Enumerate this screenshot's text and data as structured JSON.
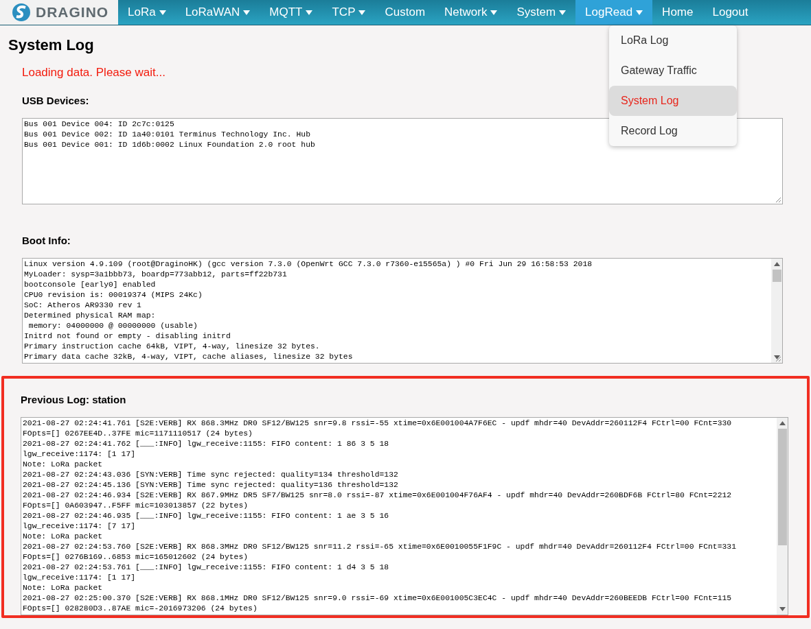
{
  "nav": {
    "logo": "DRAGINO",
    "items": [
      {
        "label": "LoRa",
        "dropdown": true,
        "selected": false
      },
      {
        "label": "LoRaWAN",
        "dropdown": true,
        "selected": false
      },
      {
        "label": "MQTT",
        "dropdown": true,
        "selected": false
      },
      {
        "label": "TCP",
        "dropdown": true,
        "selected": false
      },
      {
        "label": "Custom",
        "dropdown": false,
        "selected": false
      },
      {
        "label": "Network",
        "dropdown": true,
        "selected": false
      },
      {
        "label": "System",
        "dropdown": true,
        "selected": false
      },
      {
        "label": "LogRead",
        "dropdown": true,
        "selected": true
      },
      {
        "label": "Home",
        "dropdown": false,
        "selected": false
      },
      {
        "label": "Logout",
        "dropdown": false,
        "selected": false
      }
    ]
  },
  "dropdown": {
    "items": [
      {
        "label": "LoRa Log",
        "selected": false
      },
      {
        "label": "Gateway Traffic",
        "selected": false
      },
      {
        "label": "System Log",
        "selected": true
      },
      {
        "label": "Record Log",
        "selected": false
      }
    ]
  },
  "page_title": "System Log",
  "status_message": "Loading data. Please wait...",
  "sections": [
    {
      "heading": "USB Devices:",
      "scrollbar": false,
      "highlighted": false,
      "lines": [
        "Bus 001 Device 004: ID 2c7c:0125",
        "Bus 001 Device 002: ID 1a40:0101 Terminus Technology Inc. Hub",
        "Bus 001 Device 001: ID 1d6b:0002 Linux Foundation 2.0 root hub"
      ]
    },
    {
      "heading": "Boot Info:",
      "scrollbar": true,
      "highlighted": false,
      "lines": [
        "Linux version 4.9.109 (root@DraginoHK) (gcc version 7.3.0 (OpenWrt GCC 7.3.0 r7360-e15565a) ) #0 Fri Jun 29 16:58:53 2018",
        "MyLoader: sysp=3a1bbb73, boardp=773abb12, parts=ff22b731",
        "bootconsole [early0] enabled",
        "CPU0 revision is: 00019374 (MIPS 24Kc)",
        "SoC: Atheros AR9330 rev 1",
        "Determined physical RAM map:",
        " memory: 04000000 @ 00000000 (usable)",
        "Initrd not found or empty - disabling initrd",
        "Primary instruction cache 64kB, VIPT, 4-way, linesize 32 bytes.",
        "Primary data cache 32kB, 4-way, VIPT, cache aliases, linesize 32 bytes"
      ]
    },
    {
      "heading": "Previous Log: station",
      "scrollbar": true,
      "highlighted": true,
      "lines": [
        "2021-08-27 02:24:41.761 [S2E:VERB] RX 868.3MHz DR0 SF12/BW125 snr=9.8 rssi=-55 xtime=0x6E001004A7F6EC - updf mhdr=40 DevAddr=260112F4 FCtrl=00 FCnt=330",
        "FOpts=[] 0267EE4D..37FE mic=1171110517 (24 bytes)",
        "2021-08-27 02:24:41.762 [___:INFO] lgw_receive:1155: FIFO content: 1 86 3 5 18",
        "lgw_receive:1174: [1 17]",
        "Note: LoRa packet",
        "2021-08-27 02:24:43.036 [SYN:VERB] Time sync rejected: quality=134 threshold=132",
        "2021-08-27 02:24:45.136 [SYN:VERB] Time sync rejected: quality=136 threshold=132",
        "2021-08-27 02:24:46.934 [S2E:VERB] RX 867.9MHz DR5 SF7/BW125 snr=8.0 rssi=-87 xtime=0x6E001004F76AF4 - updf mhdr=40 DevAddr=260BDF6B FCtrl=80 FCnt=2212",
        "FOpts=[] 0A603947..F5FF mic=103013857 (22 bytes)",
        "2021-08-27 02:24:46.935 [___:INFO] lgw_receive:1155: FIFO content: 1 ae 3 5 16",
        "lgw_receive:1174: [7 17]",
        "Note: LoRa packet",
        "2021-08-27 02:24:53.760 [S2E:VERB] RX 868.3MHz DR0 SF12/BW125 snr=11.2 rssi=-65 xtime=0x6E0010055F1F9C - updf mhdr=40 DevAddr=260112F4 FCtrl=00 FCnt=331",
        "FOpts=[] 0276B169..6853 mic=165012602 (24 bytes)",
        "2021-08-27 02:24:53.761 [___:INFO] lgw_receive:1155: FIFO content: 1 d4 3 5 18",
        "lgw_receive:1174: [1 17]",
        "Note: LoRa packet",
        "2021-08-27 02:25:00.370 [S2E:VERB] RX 868.1MHz DR0 SF12/BW125 snr=9.0 rssi=-69 xtime=0x6E001005C3EC4C - updf mhdr=40 DevAddr=260BEEDB FCtrl=00 FCnt=115",
        "FOpts=[] 028280D3..87AE mic=-2016973206 (24 bytes)"
      ]
    }
  ]
}
